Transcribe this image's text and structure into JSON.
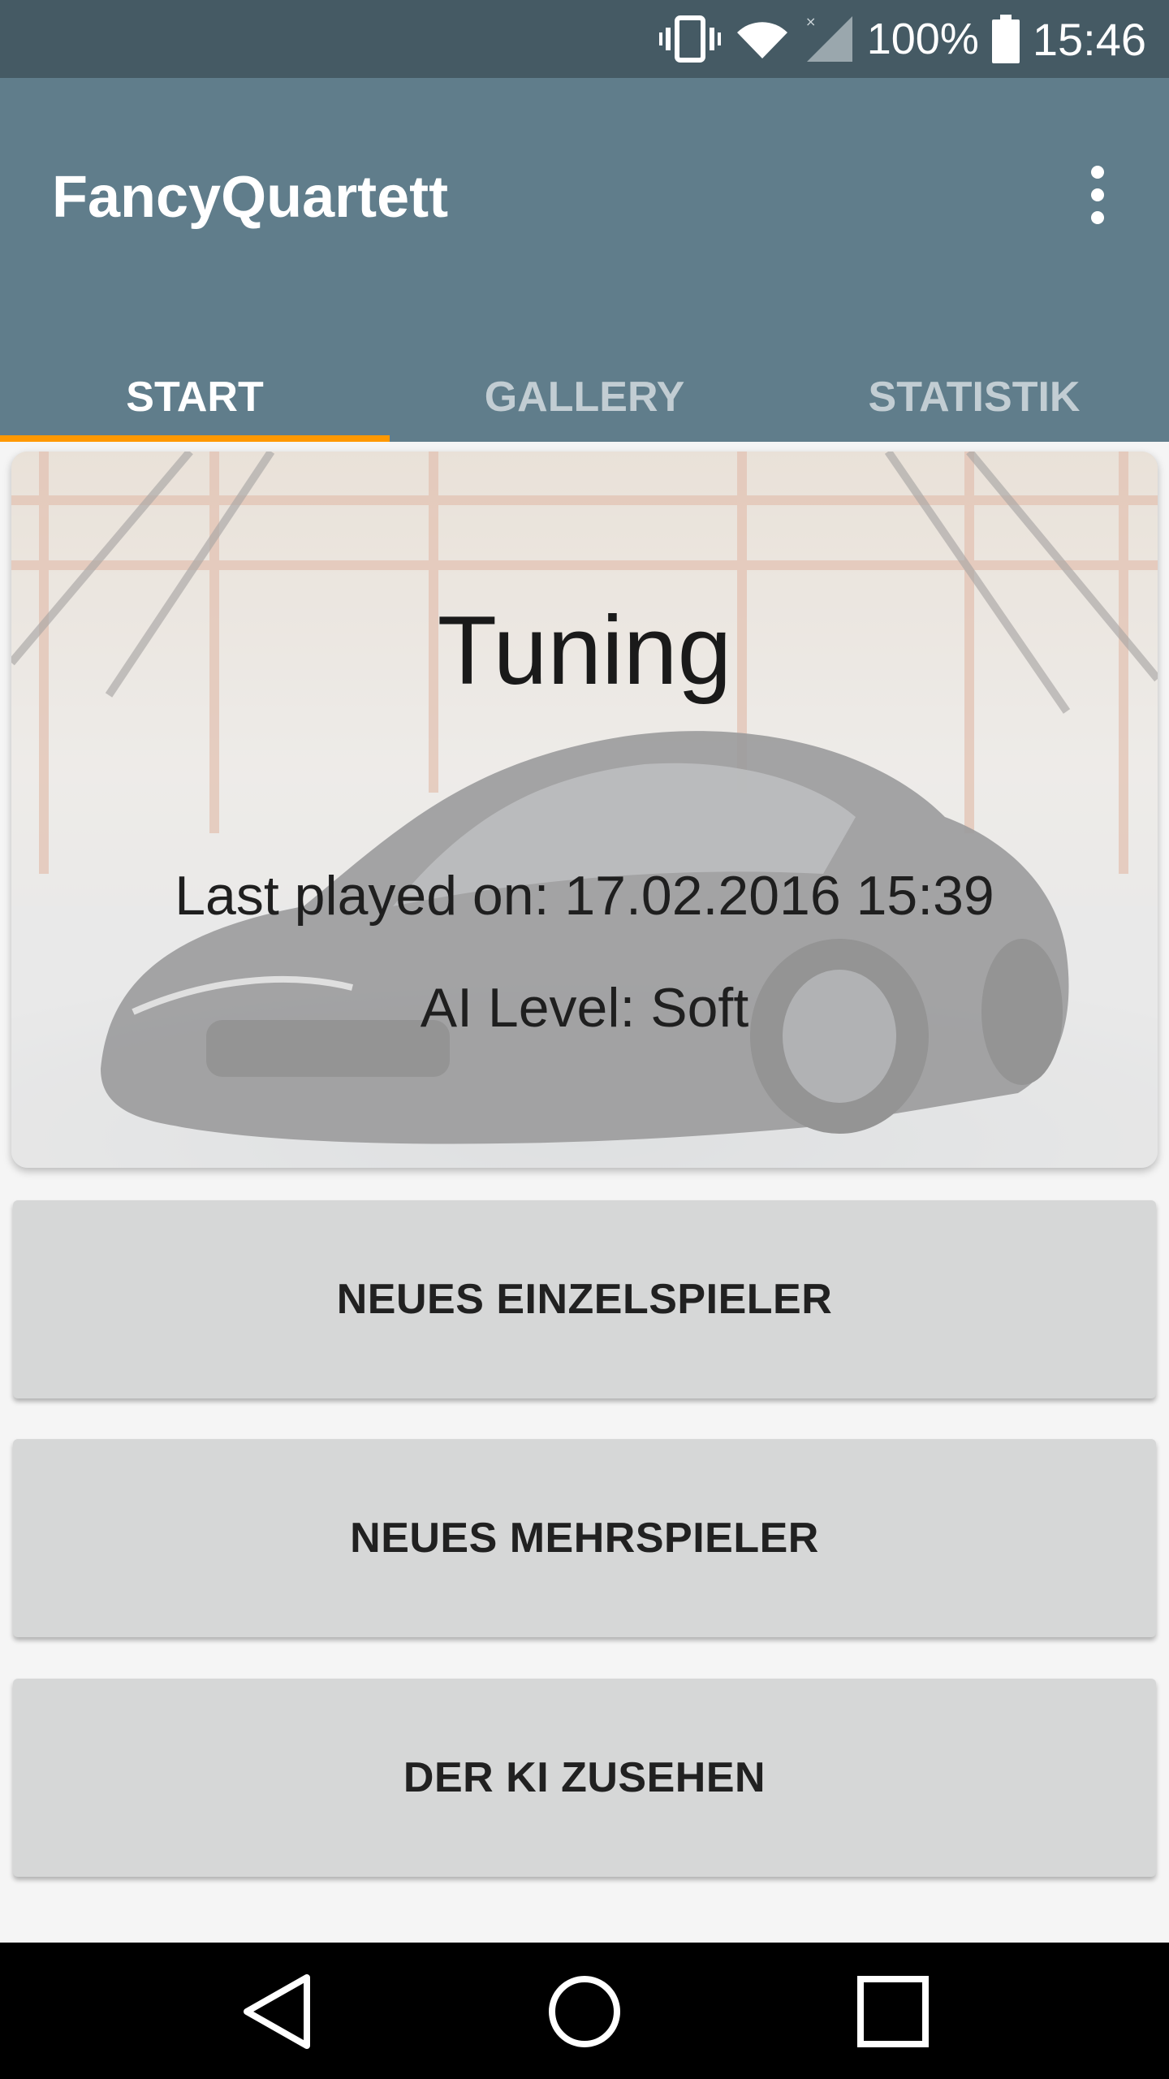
{
  "status_bar": {
    "battery_percent": "100%",
    "time": "15:46",
    "icons": [
      "vibrate-icon",
      "wifi-icon",
      "signal-icon",
      "battery-icon"
    ]
  },
  "app_bar": {
    "title": "FancyQuartett",
    "menu_icon": "overflow-menu-icon"
  },
  "tabs": [
    {
      "label": "START",
      "active": true
    },
    {
      "label": "GALLERY",
      "active": false
    },
    {
      "label": "STATISTIK",
      "active": false
    }
  ],
  "deck_card": {
    "title": "Tuning",
    "last_played": "Last played on: 17.02.2016 15:39",
    "ai_level": "AI Level: Soft"
  },
  "buttons": {
    "single_player": "NEUES EINZELSPIELER",
    "multi_player": "NEUES MEHRSPIELER",
    "watch_ai": "DER KI ZUSEHEN"
  },
  "colors": {
    "status_bar": "#455a64",
    "app_bar": "#607d8b",
    "tab_indicator": "#ff9800",
    "button_bg": "#d6d7d7"
  }
}
